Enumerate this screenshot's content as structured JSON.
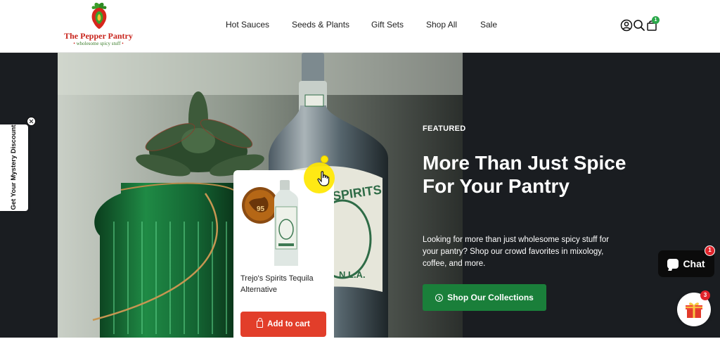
{
  "brand": {
    "name": "The Pepper Pantry",
    "tagline": "wholesome spicy stuff",
    "tagline_bullet": "•"
  },
  "nav": {
    "items": [
      {
        "label": "Hot Sauces"
      },
      {
        "label": "Seeds & Plants"
      },
      {
        "label": "Gift Sets"
      },
      {
        "label": "Shop All"
      },
      {
        "label": "Sale"
      }
    ]
  },
  "header_icons": {
    "account": "user-circle-icon",
    "search": "search-icon",
    "cart": "shopping-bag-icon",
    "cart_count": "1"
  },
  "hero": {
    "eyebrow": "FEATURED",
    "headline": "More Than Just Spice For Your Pantry",
    "body": "Looking for more than just wholesome spicy stuff for your pantry? Shop our crowd favorites in mixology, coffee, and more.",
    "cta_label": "Shop Our Collections",
    "cta_icon": "arrow-circle-icon"
  },
  "product_card": {
    "name": "Trejo's Spirits Tequila Alternative",
    "medal_score": "95",
    "button_label": "Add to cart",
    "button_icon": "bag-icon"
  },
  "side_tab": {
    "label": "Get Your Mystery Discount",
    "close_icon": "close-icon"
  },
  "chat": {
    "label": "Chat",
    "badge": "1"
  },
  "gift": {
    "icon": "gift-icon",
    "badge": "3"
  },
  "colors": {
    "brand_red": "#c8241c",
    "brand_green": "#3a7d2a",
    "cta_green": "#1a7f3a",
    "add_to_cart": "#e23e2a",
    "hero_bg": "#1a1d21",
    "badge_red": "#e0242b",
    "cart_badge": "#2aa84a"
  }
}
